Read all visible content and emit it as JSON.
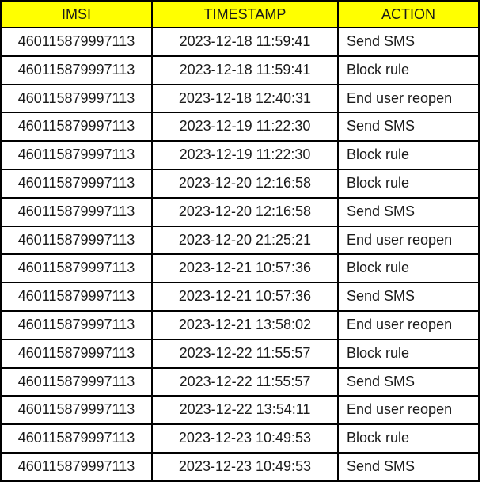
{
  "table": {
    "columns": [
      {
        "key": "imsi",
        "label": "IMSI"
      },
      {
        "key": "timestamp",
        "label": "TIMESTAMP"
      },
      {
        "key": "action",
        "label": "ACTION"
      }
    ],
    "header_background": "#ffff00",
    "header_text_color": "#1a1a1a",
    "body_text_color": "#1a1a1a",
    "highlight_text_color": "#ee1c25",
    "border_color": "#000000",
    "rows": [
      {
        "imsi": "460115879997113",
        "timestamp": "2023-12-18 11:59:41",
        "action": "Send SMS",
        "highlight": false
      },
      {
        "imsi": "460115879997113",
        "timestamp": "2023-12-18 11:59:41",
        "action": "Block rule",
        "highlight": false
      },
      {
        "imsi": "460115879997113",
        "timestamp": "2023-12-18 12:40:31",
        "action": "End user reopen",
        "highlight": true
      },
      {
        "imsi": "460115879997113",
        "timestamp": "2023-12-19 11:22:30",
        "action": "Send SMS",
        "highlight": false
      },
      {
        "imsi": "460115879997113",
        "timestamp": "2023-12-19 11:22:30",
        "action": "Block rule",
        "highlight": false
      },
      {
        "imsi": "460115879997113",
        "timestamp": "2023-12-20 12:16:58",
        "action": "Block rule",
        "highlight": false
      },
      {
        "imsi": "460115879997113",
        "timestamp": "2023-12-20 12:16:58",
        "action": "Send SMS",
        "highlight": false
      },
      {
        "imsi": "460115879997113",
        "timestamp": "2023-12-20 21:25:21",
        "action": "End user reopen",
        "highlight": true
      },
      {
        "imsi": "460115879997113",
        "timestamp": "2023-12-21 10:57:36",
        "action": "Block rule",
        "highlight": false
      },
      {
        "imsi": "460115879997113",
        "timestamp": "2023-12-21 10:57:36",
        "action": "Send SMS",
        "highlight": false
      },
      {
        "imsi": "460115879997113",
        "timestamp": "2023-12-21 13:58:02",
        "action": "End user reopen",
        "highlight": true
      },
      {
        "imsi": "460115879997113",
        "timestamp": "2023-12-22 11:55:57",
        "action": "Block rule",
        "highlight": false
      },
      {
        "imsi": "460115879997113",
        "timestamp": "2023-12-22 11:55:57",
        "action": "Send SMS",
        "highlight": false
      },
      {
        "imsi": "460115879997113",
        "timestamp": "2023-12-22 13:54:11",
        "action": "End user reopen",
        "highlight": true
      },
      {
        "imsi": "460115879997113",
        "timestamp": "2023-12-23 10:49:53",
        "action": "Block rule",
        "highlight": false
      },
      {
        "imsi": "460115879997113",
        "timestamp": "2023-12-23 10:49:53",
        "action": "Send SMS",
        "highlight": false
      }
    ]
  }
}
